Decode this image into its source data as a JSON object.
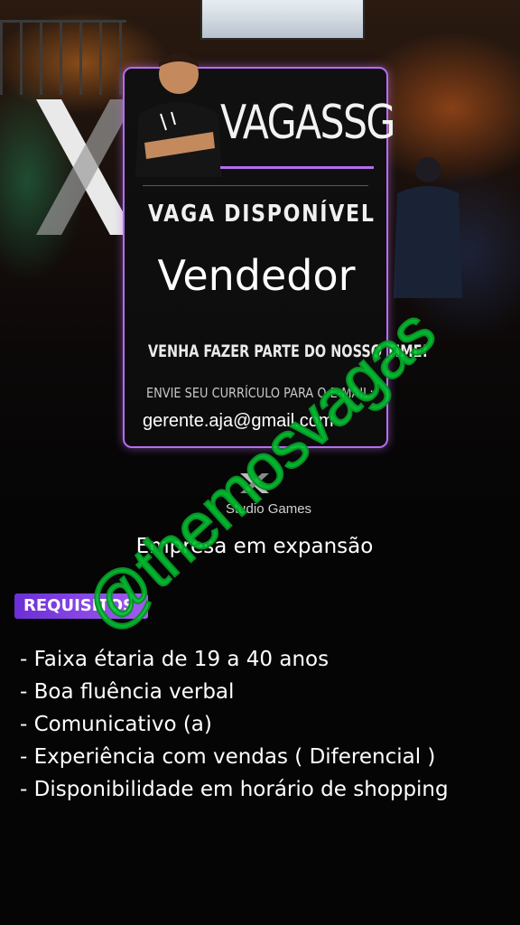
{
  "poster": {
    "brand": "VAGASSG",
    "vaga_label": "VAGA DISPONÍVEL",
    "job_title": "Vendedor",
    "cta": "VENHA FAZER PARTE DO NOSSO TIME!",
    "send_cv": "ENVIE SEU CURRÍCULO PARA O E-MAIL:",
    "email": "gerente.aja@gmail.com",
    "studio": "Studio Games"
  },
  "tagline": "Empresa em expansão",
  "requirements": {
    "badge": "REQUISITOS",
    "items": [
      "- Faixa étaria de 19 a 40 anos",
      "- Boa fluência verbal",
      "- Comunicativo (a)",
      "- Experiência com vendas ( Diferencial )",
      "- Disponibilidade em horário de shopping"
    ]
  },
  "watermark": "@themosvagas",
  "colors": {
    "accent_purple": "#b76cf0",
    "watermark_green": "#00c832",
    "background": "#050505"
  }
}
